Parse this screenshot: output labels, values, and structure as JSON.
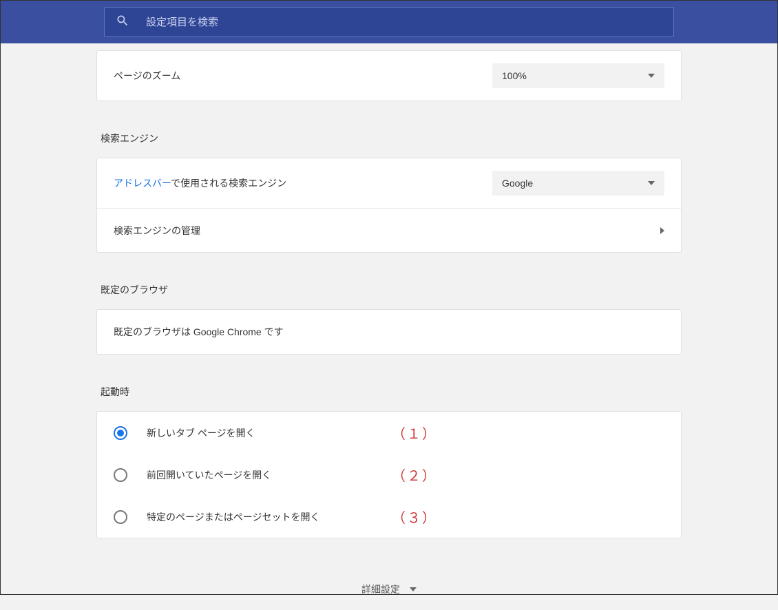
{
  "header": {
    "search_placeholder": "設定項目を検索"
  },
  "zoom": {
    "label": "ページのズーム",
    "value": "100%"
  },
  "search_engine": {
    "section_title": "検索エンジン",
    "address_bar_link": "アドレスバー",
    "address_bar_suffix": "で使用される検索エンジン",
    "selected": "Google",
    "manage_label": "検索エンジンの管理"
  },
  "default_browser": {
    "section_title": "既定のブラウザ",
    "status": "既定のブラウザは Google Chrome です"
  },
  "startup": {
    "section_title": "起動時",
    "options": [
      {
        "label": "新しいタブ ページを開く",
        "annotation": "（１）",
        "selected": true
      },
      {
        "label": "前回開いていたページを開く",
        "annotation": "（２）",
        "selected": false
      },
      {
        "label": "特定のページまたはページセットを開く",
        "annotation": "（３）",
        "selected": false
      }
    ]
  },
  "advanced": {
    "label": "詳細設定"
  }
}
